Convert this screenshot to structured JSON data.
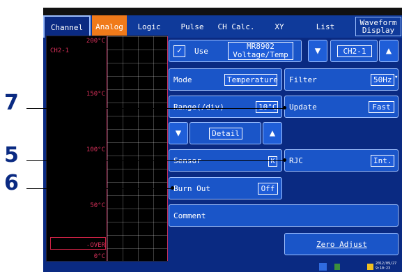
{
  "tabs": [
    {
      "label": "Channel"
    },
    {
      "label": "Analog"
    },
    {
      "label": "Logic"
    },
    {
      "label": "Pulse"
    },
    {
      "label": "CH Calc."
    },
    {
      "label": "XY"
    },
    {
      "label": "List"
    },
    {
      "label": "Waveform\nDisplay"
    }
  ],
  "graph": {
    "channel": "CH2-1",
    "y_labels": [
      "200°C",
      "150°C",
      "100°C",
      "50°C",
      "-OVER",
      "0°C"
    ]
  },
  "settings": {
    "use_checkbox": "✓",
    "use_label": "Use",
    "module_line1": "MR8902",
    "module_line2": "Voltage/Temp",
    "channel_value": "CH2-1",
    "mode_label": "Mode",
    "mode_value": "Temperature",
    "filter_label": "Filter",
    "filter_value": "50Hz",
    "range_label": "Range(/div)",
    "range_value": "10°C",
    "update_label": "Update",
    "update_value": "Fast",
    "detail_label": "Detail",
    "sensor_label": "Sensor",
    "sensor_value": "K",
    "rjc_label": "RJC",
    "rjc_value": "Int.",
    "burnout_label": "Burn Out",
    "burnout_value": "Off",
    "comment_label": "Comment",
    "zero_adjust_label": "Zero Adjust"
  },
  "callouts": [
    "7",
    "5",
    "6"
  ],
  "status": {
    "date": "2012/09/27",
    "time": "9:10:23"
  },
  "colors": {
    "screen_bg": "#0a2a82",
    "active_tab": "#f07a1a",
    "panel": "#1a55c8",
    "graph_red": "#d8305a"
  }
}
